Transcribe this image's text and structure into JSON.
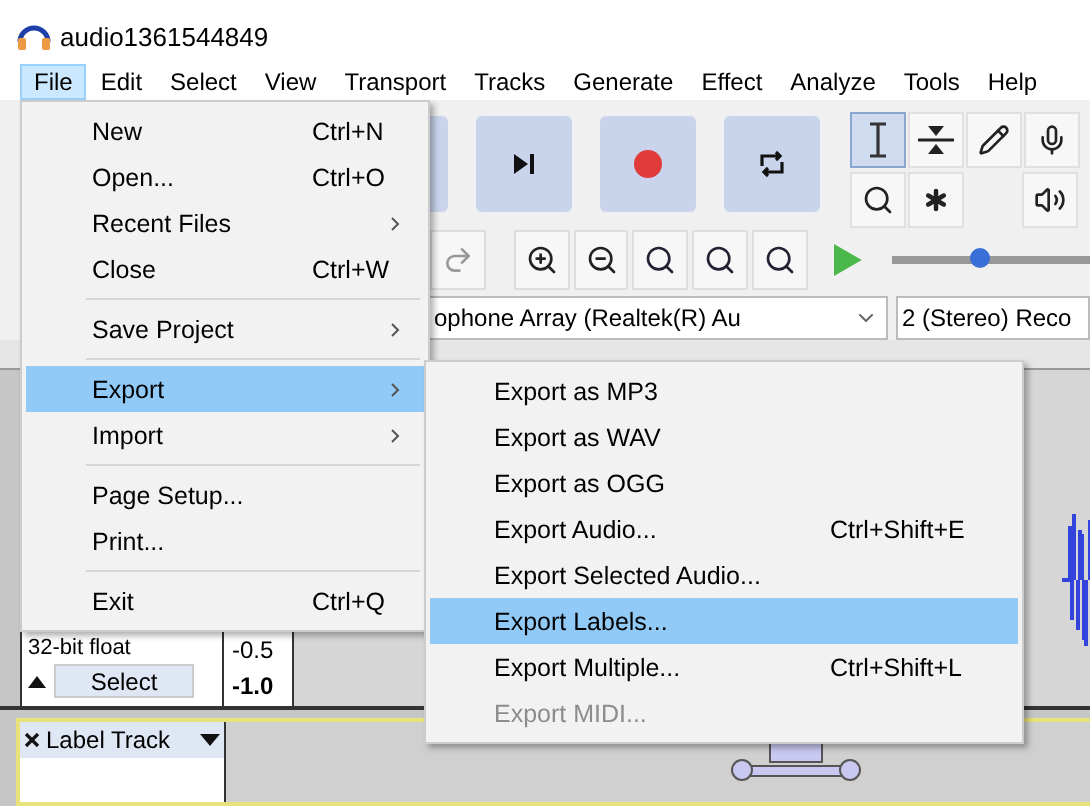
{
  "window": {
    "title": "audio1361544849"
  },
  "menubar": [
    {
      "label": "File",
      "selected": true
    },
    {
      "label": "Edit",
      "selected": false
    },
    {
      "label": "Select",
      "selected": false
    },
    {
      "label": "View",
      "selected": false
    },
    {
      "label": "Transport",
      "selected": false
    },
    {
      "label": "Tracks",
      "selected": false
    },
    {
      "label": "Generate",
      "selected": false
    },
    {
      "label": "Effect",
      "selected": false
    },
    {
      "label": "Analyze",
      "selected": false
    },
    {
      "label": "Tools",
      "selected": false
    },
    {
      "label": "Help",
      "selected": false
    }
  ],
  "tools": [
    {
      "kind": "ibeam",
      "selected": true
    },
    {
      "kind": "envelope",
      "selected": false
    },
    {
      "kind": "pencil",
      "selected": false
    },
    {
      "kind": "zoom",
      "selected": false
    },
    {
      "kind": "multi",
      "selected": false
    }
  ],
  "speed_slider": {
    "level": 0.45
  },
  "device_toolbar": {
    "input_device": "ophone Array (Realtek(R) Au",
    "channels": "2 (Stereo) Reco"
  },
  "audio_track": {
    "format": "32-bit float",
    "select_button": "Select",
    "scale": [
      "-0.5",
      "-1.0"
    ]
  },
  "label_track": {
    "name": "Label Track"
  },
  "file_menu": [
    {
      "kind": "item",
      "label": "New",
      "shortcut": "Ctrl+N",
      "submenu": false,
      "selected": false
    },
    {
      "kind": "item",
      "label": "Open...",
      "shortcut": "Ctrl+O",
      "submenu": false,
      "selected": false
    },
    {
      "kind": "item",
      "label": "Recent Files",
      "submenu": true,
      "selected": false
    },
    {
      "kind": "item",
      "label": "Close",
      "shortcut": "Ctrl+W",
      "submenu": false,
      "selected": false
    },
    {
      "kind": "separator"
    },
    {
      "kind": "item",
      "label": "Save Project",
      "submenu": true,
      "selected": false
    },
    {
      "kind": "separator"
    },
    {
      "kind": "item",
      "label": "Export",
      "submenu": true,
      "selected": true
    },
    {
      "kind": "item",
      "label": "Import",
      "submenu": true,
      "selected": false
    },
    {
      "kind": "separator"
    },
    {
      "kind": "item",
      "label": "Page Setup...",
      "submenu": false,
      "selected": false
    },
    {
      "kind": "item",
      "label": "Print...",
      "submenu": false,
      "selected": false
    },
    {
      "kind": "separator"
    },
    {
      "kind": "item",
      "label": "Exit",
      "shortcut": "Ctrl+Q",
      "submenu": false,
      "selected": false
    }
  ],
  "export_menu": [
    {
      "label": "Export as MP3",
      "selected": false,
      "disabled": false
    },
    {
      "label": "Export as WAV",
      "selected": false,
      "disabled": false
    },
    {
      "label": "Export as OGG",
      "selected": false,
      "disabled": false
    },
    {
      "label": "Export Audio...",
      "shortcut": "Ctrl+Shift+E",
      "selected": false,
      "disabled": false
    },
    {
      "label": "Export Selected Audio...",
      "selected": false,
      "disabled": false
    },
    {
      "label": "Export Labels...",
      "selected": true,
      "disabled": false
    },
    {
      "label": "Export Multiple...",
      "shortcut": "Ctrl+Shift+L",
      "selected": false,
      "disabled": false
    },
    {
      "label": "Export MIDI...",
      "selected": false,
      "disabled": true
    }
  ]
}
